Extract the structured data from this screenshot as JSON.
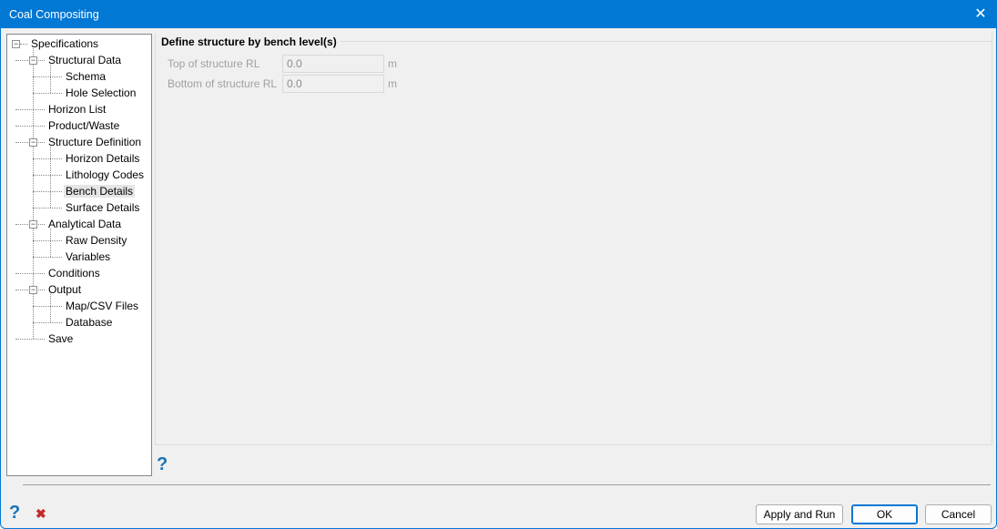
{
  "window": {
    "title": "Coal Compositing"
  },
  "tree": [
    {
      "label": "Specifications",
      "level": 0,
      "expander": true
    },
    {
      "label": "Structural Data",
      "level": 1,
      "expander": true
    },
    {
      "label": "Schema",
      "level": 2
    },
    {
      "label": "Hole Selection",
      "level": 2
    },
    {
      "label": "Horizon List",
      "level": 1
    },
    {
      "label": "Product/Waste",
      "level": 1
    },
    {
      "label": "Structure Definition",
      "level": 1,
      "expander": true
    },
    {
      "label": "Horizon Details",
      "level": 2
    },
    {
      "label": "Lithology Codes",
      "level": 2
    },
    {
      "label": "Bench Details",
      "level": 2,
      "selected": true
    },
    {
      "label": "Surface Details",
      "level": 2
    },
    {
      "label": "Analytical Data",
      "level": 1,
      "expander": true
    },
    {
      "label": "Raw Density",
      "level": 2
    },
    {
      "label": "Variables",
      "level": 2
    },
    {
      "label": "Conditions",
      "level": 1
    },
    {
      "label": "Output",
      "level": 1,
      "expander": true
    },
    {
      "label": "Map/CSV Files",
      "level": 2
    },
    {
      "label": "Database",
      "level": 2
    },
    {
      "label": "Save",
      "level": 1
    }
  ],
  "group": {
    "title": "Define structure by bench level(s)",
    "fields": [
      {
        "label": "Top of structure RL",
        "value": "0.0",
        "unit": "m"
      },
      {
        "label": "Bottom of structure RL",
        "value": "0.0",
        "unit": "m"
      }
    ]
  },
  "buttons": {
    "apply_run": "Apply and Run",
    "ok": "OK",
    "cancel": "Cancel"
  },
  "icons": {
    "help": "?",
    "cancel": "✖",
    "close": "✕"
  }
}
